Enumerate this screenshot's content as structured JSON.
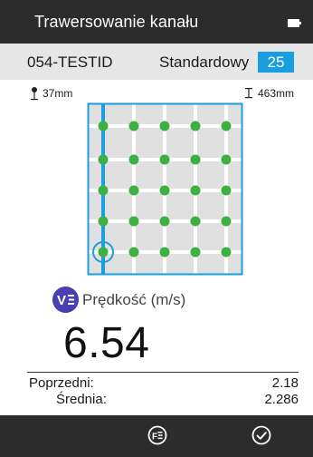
{
  "header": {
    "title": "Trawersowanie kanału",
    "battery_icon": "battery-icon"
  },
  "info": {
    "id": "054-TESTID",
    "mode": "Standardowy",
    "count": "25"
  },
  "measurements": {
    "left": "37mm",
    "right": "463mm"
  },
  "grid": {
    "rows": 5,
    "cols": 5,
    "point_color": "#3cb043",
    "line_color": "#1a9ee0",
    "cell_color": "#e0e0e0"
  },
  "velocity": {
    "icon": "velocity-icon",
    "label": "Prędkość (m/s)",
    "value": "6.54"
  },
  "stats": {
    "previous_label": "Poprzedni:",
    "previous_value": "2.18",
    "average_label": "Średnia:",
    "average_value": "2.286"
  },
  "footer": {
    "stats_icon": "stats-icon",
    "confirm_icon": "checkmark-icon"
  },
  "colors": {
    "dark_bar": "#2c2c2c",
    "accent": "#1a9ee0",
    "badge_bg": "#1a9ee0",
    "velocity_icon_bg": "#4a3fb0"
  }
}
